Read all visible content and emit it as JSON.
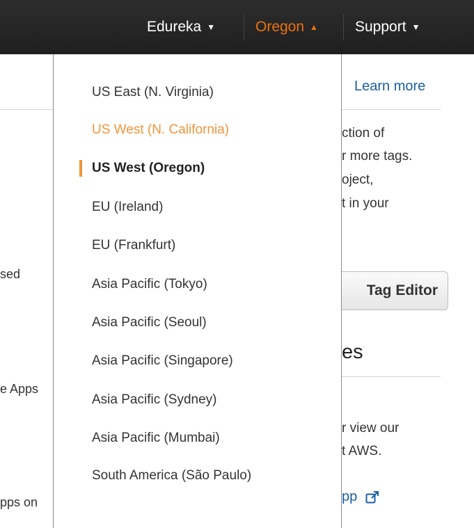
{
  "navbar": {
    "account_label": "Edureka",
    "region_label": "Oregon",
    "support_label": "Support",
    "caret_down": "▼",
    "caret_up": "▲",
    "active_color": "#ec7211"
  },
  "background_page": {
    "learn_more": "Learn more",
    "para_line1": "ction of",
    "para_line2": "r more tags.",
    "para_line3": "oject,",
    "para_line4": "t in your",
    "left_frag1": "sed",
    "left_frag2": "e Apps",
    "left_frag3": "pps on",
    "tag_editor_button": "Tag Editor",
    "section_heading": "es",
    "para2_line1": "r view our",
    "para2_line2": "t AWS.",
    "app_link": "pp",
    "external_link_icon": "external-link-icon"
  },
  "region_menu": {
    "items": [
      {
        "label": "US East (N. Virginia)",
        "state": "normal"
      },
      {
        "label": "US West (N. California)",
        "state": "hover"
      },
      {
        "label": "US West (Oregon)",
        "state": "selected"
      },
      {
        "label": "EU (Ireland)",
        "state": "normal"
      },
      {
        "label": "EU (Frankfurt)",
        "state": "normal"
      },
      {
        "label": "Asia Pacific (Tokyo)",
        "state": "normal"
      },
      {
        "label": "Asia Pacific (Seoul)",
        "state": "normal"
      },
      {
        "label": "Asia Pacific (Singapore)",
        "state": "normal"
      },
      {
        "label": "Asia Pacific (Sydney)",
        "state": "normal"
      },
      {
        "label": "Asia Pacific (Mumbai)",
        "state": "normal"
      },
      {
        "label": "South America (São Paulo)",
        "state": "normal"
      }
    ],
    "hover_color": "#f0953a",
    "selected_marker_color": "#f0953a"
  }
}
